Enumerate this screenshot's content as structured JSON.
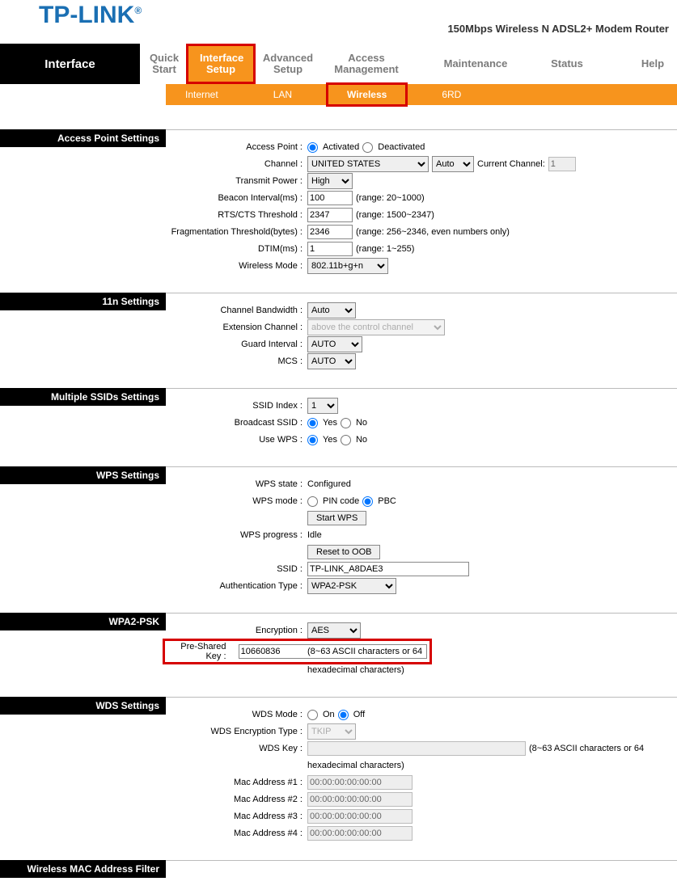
{
  "brand": "TP-LINK",
  "product": "150Mbps Wireless N ADSL2+ Modem Router",
  "leftNavLabel": "Interface",
  "topTabs": {
    "quick": "Quick\nStart",
    "iface": "Interface\nSetup",
    "adv": "Advanced\nSetup",
    "access": "Access\nManagement",
    "maint": "Maintenance",
    "status": "Status",
    "help": "Help"
  },
  "subTabs": {
    "internet": "Internet",
    "lan": "LAN",
    "wireless": "Wireless",
    "sixrd": "6RD"
  },
  "sections": {
    "ap": "Access Point Settings",
    "n11": "11n Settings",
    "mssid": "Multiple SSIDs Settings",
    "wps": "WPS Settings",
    "wpa": "WPA2-PSK",
    "wds": "WDS Settings",
    "macf": "Wireless MAC Address Filter"
  },
  "ap": {
    "labels": {
      "ap": "Access Point :",
      "channel": "Channel :",
      "txp": "Transmit Power :",
      "beacon": "Beacon Interval(ms) :",
      "rts": "RTS/CTS Threshold :",
      "frag": "Fragmentation Threshold(bytes) :",
      "dtim": "DTIM(ms) :",
      "mode": "Wireless Mode :"
    },
    "activated": "Activated",
    "deactivated": "Deactivated",
    "country": "UNITED STATES",
    "auto": "Auto",
    "curChLabel": "Current Channel:",
    "curCh": "1",
    "txp": "High",
    "beacon": "100",
    "beaconNote": "(range: 20~1000)",
    "rts": "2347",
    "rtsNote": "(range: 1500~2347)",
    "frag": "2346",
    "fragNote": "(range: 256~2346, even numbers only)",
    "dtim": "1",
    "dtimNote": "(range: 1~255)",
    "mode": "802.11b+g+n"
  },
  "n11": {
    "labels": {
      "cbw": "Channel Bandwidth :",
      "ext": "Extension Channel :",
      "gi": "Guard Interval :",
      "mcs": "MCS :"
    },
    "cbw": "Auto",
    "ext": "above the control channel",
    "gi": "AUTO",
    "mcs": "AUTO"
  },
  "mssid": {
    "labels": {
      "idx": "SSID Index :",
      "bcast": "Broadcast SSID :",
      "wps": "Use WPS :"
    },
    "idx": "1",
    "yes": "Yes",
    "no": "No"
  },
  "wps": {
    "labels": {
      "state": "WPS state :",
      "mode": "WPS mode :",
      "prog": "WPS progress :",
      "ssid": "SSID :",
      "auth": "Authentication Type :"
    },
    "state": "Configured",
    "pin": "PIN code",
    "pbc": "PBC",
    "startBtn": "Start WPS",
    "prog": "Idle",
    "resetBtn": "Reset to OOB",
    "ssid": "TP-LINK_A8DAE3",
    "auth": "WPA2-PSK"
  },
  "wpa": {
    "labels": {
      "enc": "Encryption :",
      "psk": "Pre-Shared Key :"
    },
    "enc": "AES",
    "psk": "10660836",
    "pskNote1": "(8~63 ASCII characters or 64",
    "pskNote2": "hexadecimal characters)"
  },
  "wds": {
    "labels": {
      "mode": "WDS Mode :",
      "enc": "WDS Encryption Type :",
      "key": "WDS Key :",
      "mac1": "Mac Address #1 :",
      "mac2": "Mac Address #2 :",
      "mac3": "Mac Address #3 :",
      "mac4": "Mac Address #4 :"
    },
    "on": "On",
    "off": "Off",
    "enc": "TKIP",
    "key": "",
    "keyNote1": "(8~63 ASCII characters or 64",
    "keyNote2": "hexadecimal characters)",
    "mac": "00:00:00:00:00:00"
  }
}
